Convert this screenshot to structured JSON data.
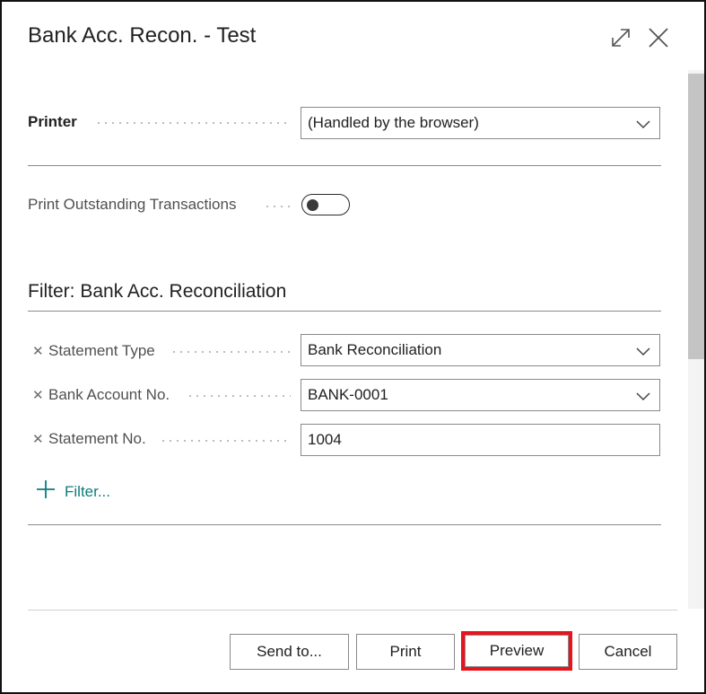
{
  "dialog": {
    "title": "Bank Acc. Recon. - Test",
    "expand_icon": "expand-icon",
    "close_icon": "close-icon"
  },
  "options": {
    "printer_label": "Printer",
    "printer_value": "(Handled by the browser)",
    "print_outstanding_label": "Print Outstanding Transactions",
    "print_outstanding_on": false
  },
  "filter": {
    "section_title": "Filter: Bank Acc. Reconciliation",
    "rows": [
      {
        "label": "Statement Type",
        "value": "Bank Reconciliation",
        "type": "select"
      },
      {
        "label": "Bank Account No.",
        "value": "BANK-0001",
        "type": "select"
      },
      {
        "label": "Statement No.",
        "value": "1004",
        "type": "text"
      }
    ],
    "add_filter_label": "Filter..."
  },
  "footer": {
    "send_to_label": "Send to...",
    "print_label": "Print",
    "preview_label": "Preview",
    "cancel_label": "Cancel"
  },
  "colors": {
    "accent": "#0d7c7c",
    "highlight": "#e8141c"
  }
}
